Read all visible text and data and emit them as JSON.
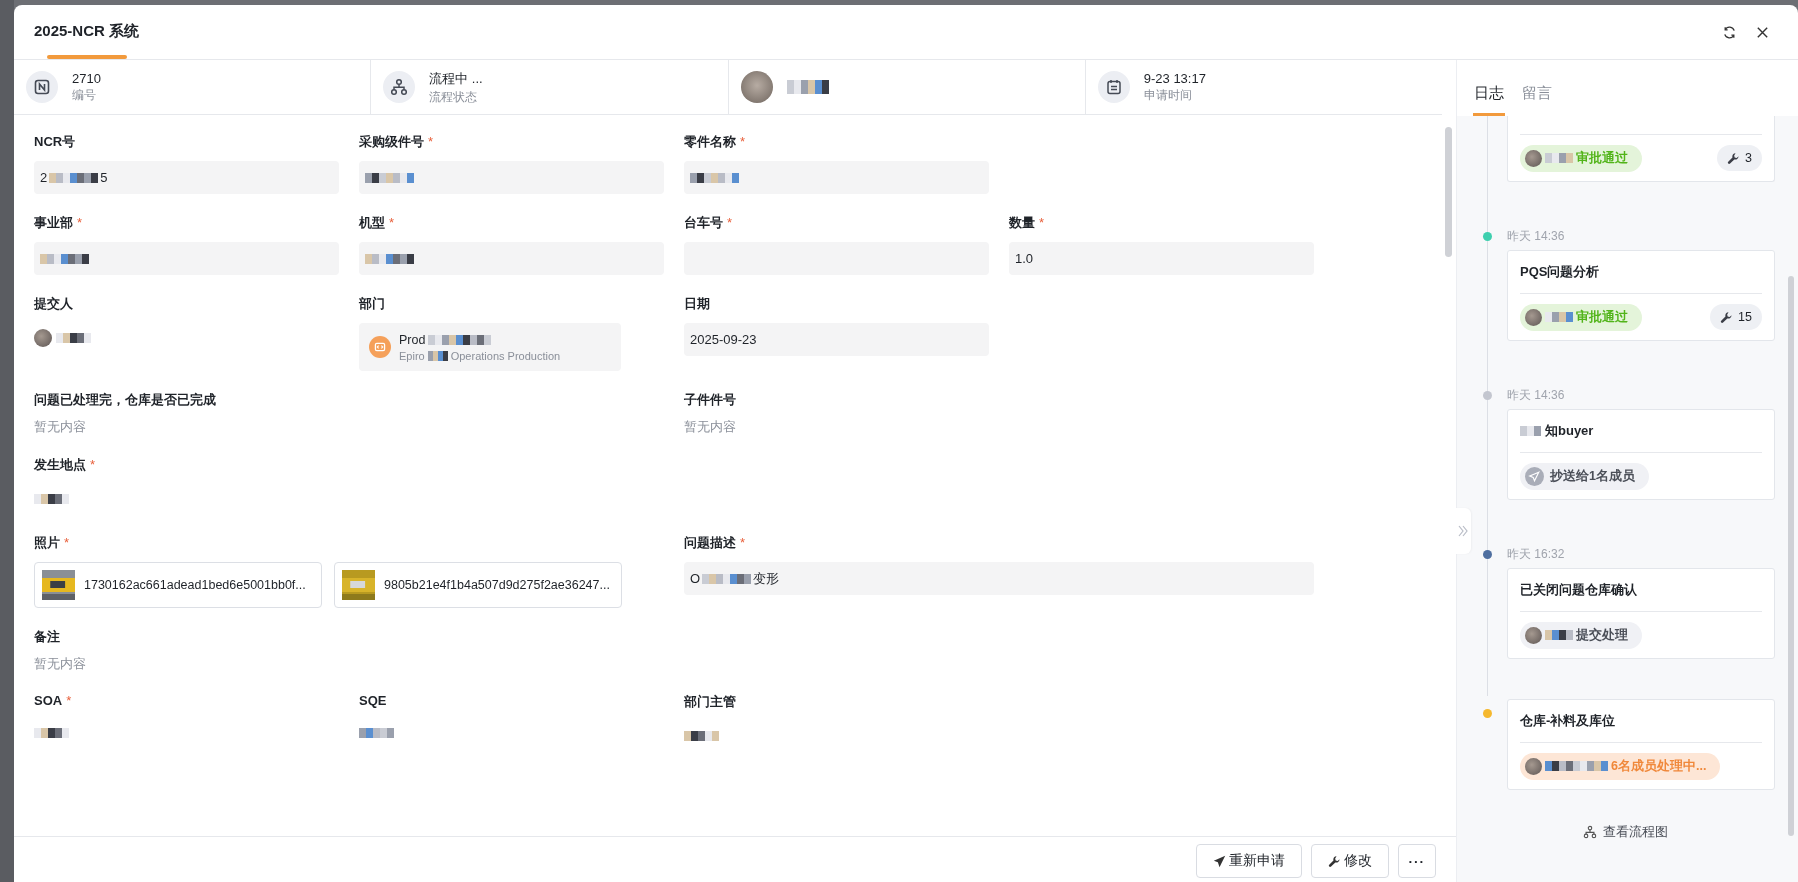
{
  "window": {
    "title": "2025-NCR 系统"
  },
  "info": [
    {
      "kind": "number",
      "value": "2710",
      "label": "编号"
    },
    {
      "kind": "flow",
      "value": "流程中 ...",
      "label": "流程状态"
    },
    {
      "kind": "person",
      "parts": [
        {
          "kind": "redacted"
        }
      ]
    },
    {
      "kind": "date",
      "value": "9-23 13:17",
      "label": "申请时间"
    }
  ],
  "form": [
    [
      {
        "label": "NCR号",
        "kind": "input",
        "parts": [
          {
            "text": "2"
          },
          {
            "kind": "redacted"
          },
          {
            "text": "5"
          }
        ]
      },
      {
        "label": "采购级件号",
        "required_mark": "*",
        "kind": "input",
        "parts": [
          {
            "kind": "redacted"
          }
        ]
      },
      {
        "label": "零件名称",
        "required_mark": "*",
        "kind": "input",
        "parts": [
          {
            "kind": "redacted"
          }
        ]
      }
    ],
    [
      {
        "label": "事业部",
        "required_mark": "*",
        "kind": "input",
        "parts": [
          {
            "kind": "redacted"
          }
        ]
      },
      {
        "label": "机型",
        "required_mark": "*",
        "kind": "input",
        "parts": [
          {
            "kind": "redacted"
          }
        ]
      },
      {
        "label": "台车号",
        "required_mark": "*",
        "kind": "input"
      },
      {
        "label": "数量",
        "required_mark": "*",
        "kind": "input",
        "parts": [
          {
            "text": "1.0"
          }
        ]
      }
    ],
    [
      {
        "label": "提交人",
        "kind": "person",
        "parts": [
          {
            "kind": "avatar"
          },
          {
            "kind": "redacted"
          }
        ]
      },
      {
        "label": "部门",
        "kind": "dept",
        "parts": [
          {
            "text": "Prod"
          },
          {
            "kind": "redacted"
          }
        ],
        "sub": "Epiro",
        "sub2": "Operations Production"
      },
      {
        "label": "日期",
        "kind": "input",
        "parts": [
          {
            "text": "2025-09-23"
          }
        ]
      }
    ],
    [
      {
        "label": "问题已处理完，仓库是否已完成",
        "kind": "empty",
        "wide": true,
        "empty": "暂无内容"
      },
      {
        "label": "子件件号",
        "kind": "empty",
        "wide": false,
        "empty": "暂无内容"
      }
    ],
    [
      {
        "label": "发生地点",
        "required_mark": "*",
        "kind": "person",
        "parts": [
          {
            "kind": "redacted"
          }
        ]
      }
    ],
    [
      {
        "label": "照片",
        "required_mark": "*",
        "kind": "files",
        "wide": true,
        "files": [
          "1730162ac661adead1bed6e5001bb0f...",
          "9805b21e4f1b4a507d9d275f2ae36247..."
        ]
      },
      {
        "label": "问题描述",
        "required_mark": "*",
        "kind": "input",
        "wide": true,
        "parts": [
          {
            "text": "O"
          },
          {
            "kind": "redacted"
          },
          {
            "text": "变形"
          }
        ]
      }
    ],
    [
      {
        "label": "备注",
        "kind": "empty",
        "wide": false,
        "empty": "暂无内容"
      }
    ],
    [
      {
        "label": "SOA",
        "required_mark": "*",
        "kind": "person",
        "parts": [
          {
            "kind": "redacted"
          }
        ]
      },
      {
        "label": "SQE",
        "kind": "person",
        "parts": [
          {
            "kind": "redacted"
          }
        ]
      },
      {
        "label": "部门主管",
        "kind": "person",
        "parts": [
          {
            "kind": "redacted"
          }
        ]
      }
    ]
  ],
  "footer_buttons": [
    {
      "kind": "resubmit",
      "label": "重新申请"
    },
    {
      "kind": "edit",
      "label": "修改"
    },
    {
      "kind": "more",
      "label": "···"
    }
  ],
  "side_tabs": [
    {
      "label": "日志",
      "selected": true
    },
    {
      "label": "留言",
      "selected": false
    }
  ],
  "timeline": [
    {
      "cut": true,
      "badge": {
        "kind": "success",
        "parts": [
          {
            "kind": "avatar"
          },
          {
            "kind": "redacted"
          },
          {
            "text": "审批通过"
          }
        ]
      },
      "count": "3"
    },
    {
      "time": "昨天 14:36",
      "color": "#3ecfae",
      "title": [
        {
          "text": "PQS问题分析"
        }
      ],
      "badge": {
        "kind": "success",
        "parts": [
          {
            "kind": "avatar"
          },
          {
            "kind": "redacted"
          },
          {
            "text": "审批通过"
          }
        ]
      },
      "count": "15"
    },
    {
      "time": "昨天 14:36",
      "color": "#c3c6cf",
      "title": [
        {
          "kind": "redacted"
        },
        {
          "text": "知buyer"
        }
      ],
      "badge": {
        "kind": "neutral",
        "parts": [
          {
            "kind": "send"
          },
          {
            "text": "抄送给1名成员"
          }
        ]
      }
    },
    {
      "time": "昨天 16:32",
      "color": "#4f6fa0",
      "title": [
        {
          "text": "已关闭问题仓库确认"
        }
      ],
      "badge": {
        "kind": "neutral",
        "parts": [
          {
            "kind": "avatar"
          },
          {
            "kind": "redacted"
          },
          {
            "text": "提交处理"
          }
        ]
      }
    },
    {
      "color": "#f5b82e",
      "title": [
        {
          "text": "仓库-补料及库位"
        }
      ],
      "badge": {
        "kind": "warning",
        "parts": [
          {
            "kind": "avatar"
          },
          {
            "kind": "redacted"
          },
          {
            "text": "6名成员处理中..."
          }
        ]
      }
    }
  ],
  "flow_link": "查看流程图"
}
